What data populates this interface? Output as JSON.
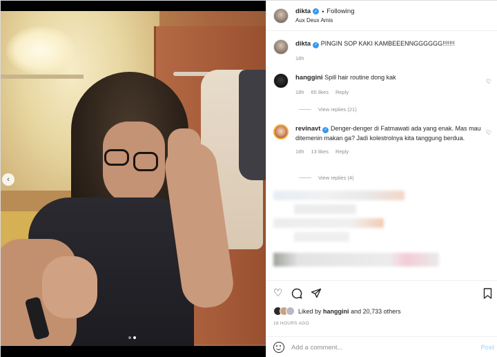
{
  "header": {
    "username": "dikta",
    "separator": "•",
    "follow_status": "Following",
    "location": "Aux Deux Amis"
  },
  "caption": {
    "username": "dikta",
    "text": "PINGIN SOP KAKI KAMBEEENNGGGGGG!!!!!!!",
    "time": "18h"
  },
  "comments": [
    {
      "username": "hanggini",
      "verified": false,
      "text": "Spill hair routine dong kak",
      "time": "18h",
      "likes": "65 likes",
      "reply_label": "Reply",
      "view_replies": "View replies (21)"
    },
    {
      "username": "revinavt",
      "verified": true,
      "text": "Denger-denger di Fatmawati ada yang enak. Mas mau ditemenin makan ga? Jadi kolestrolnya kita tanggung berdua.",
      "time": "18h",
      "likes": "13 likes",
      "reply_label": "Reply",
      "view_replies": "View replies (4)"
    }
  ],
  "actions": {
    "icons": [
      "heart-icon",
      "comment-icon",
      "share-icon",
      "bookmark-icon"
    ]
  },
  "likes": {
    "prefix": "Liked by",
    "user": "hanggini",
    "suffix": "and 20,733 others"
  },
  "timestamp": "18 HOURS AGO",
  "add_comment": {
    "placeholder": "Add a comment...",
    "post_label": "Post"
  },
  "colors": {
    "verified": "#3897f0",
    "link_disabled": "#b2dffc",
    "secondary_text": "#8e8e8e"
  }
}
